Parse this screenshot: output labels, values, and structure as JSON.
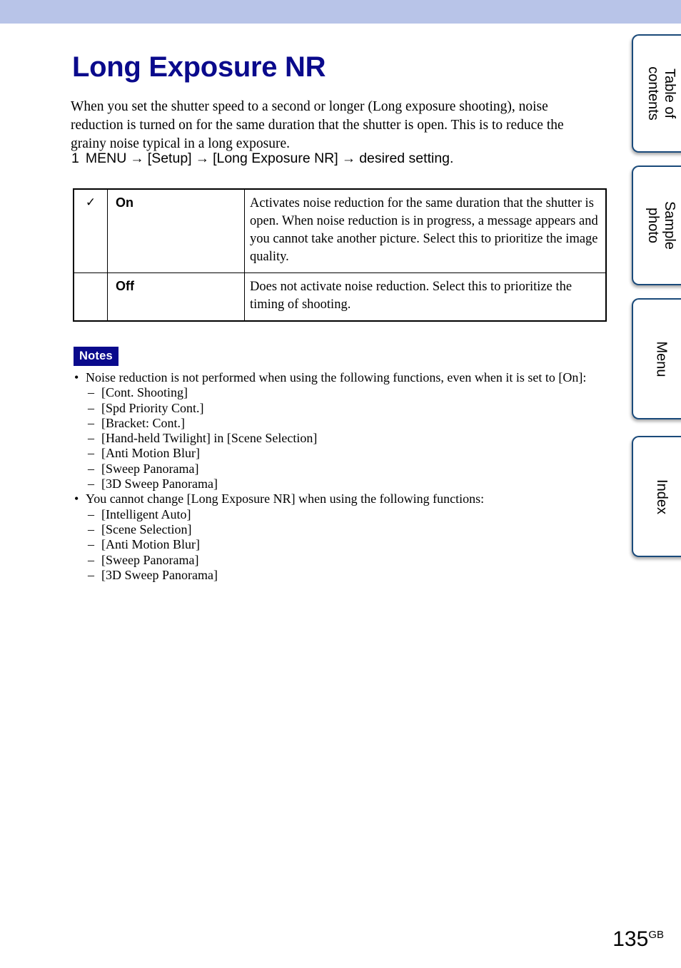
{
  "banner": {
    "color": "#b8c4e8"
  },
  "page": {
    "title": "Long Exposure NR",
    "title_color": "#0a0a8c",
    "intro": "When you set the shutter speed to a second or longer (Long exposure shooting), noise reduction is turned on for the same duration that the shutter is open. This is to reduce the grainy noise typical in a long exposure.",
    "number": "135",
    "number_suffix": "GB"
  },
  "step": {
    "num": "1",
    "menu": "MENU",
    "arrow": "→",
    "part1": "[Setup]",
    "part2": "[Long Exposure NR]",
    "part3": "desired setting."
  },
  "settings_table": {
    "rows": [
      {
        "check": "✓",
        "has_check": true,
        "label": "On",
        "description": "Activates noise reduction for the same duration that the shutter is open. When noise reduction is in progress, a message appears and you cannot take another picture. Select this to prioritize the image quality."
      },
      {
        "check": "",
        "has_check": false,
        "label": "Off",
        "description": "Does not activate noise reduction. Select this to prioritize the timing of shooting."
      }
    ]
  },
  "notes": {
    "badge_label": "Notes",
    "badge_bg": "#0a0a8c",
    "badge_color": "#ffffff",
    "groups": [
      {
        "bullet": "Noise reduction is not performed when using the following functions, even when it is set to [On]:",
        "items": [
          "[Cont. Shooting]",
          "[Spd Priority Cont.]",
          "[Bracket: Cont.]",
          "[Hand-held Twilight] in [Scene Selection]",
          "[Anti Motion Blur]",
          "[Sweep Panorama]",
          "[3D Sweep Panorama]"
        ]
      },
      {
        "bullet": "You cannot change [Long Exposure NR] when using the following functions:",
        "items": [
          "[Intelligent Auto]",
          "[Scene Selection]",
          "[Anti Motion Blur]",
          "[Sweep Panorama]",
          "[3D Sweep Panorama]"
        ]
      }
    ]
  },
  "side_tabs": {
    "border_color": "#1a4a7a",
    "items": [
      {
        "label": "Table of\ncontents"
      },
      {
        "label": "Sample photo"
      },
      {
        "label": "Menu"
      },
      {
        "label": "Index"
      }
    ]
  }
}
